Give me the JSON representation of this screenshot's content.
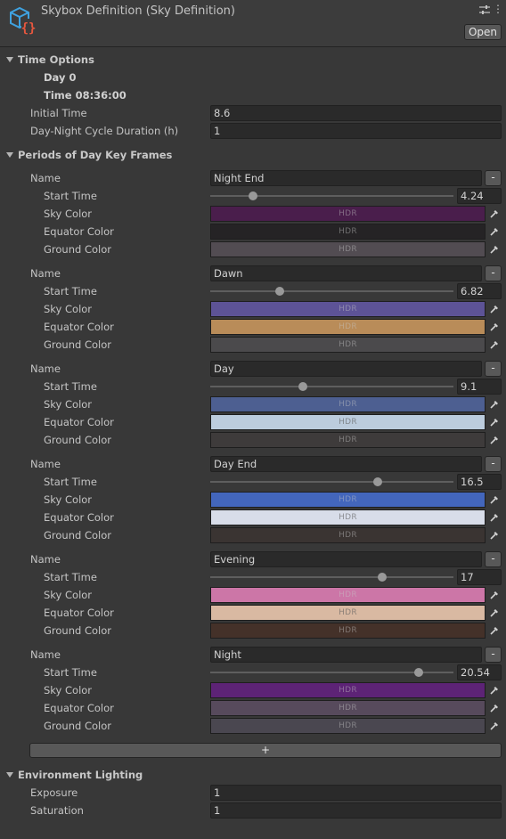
{
  "header": {
    "title": "Skybox Definition (Sky Definition)",
    "open_label": "Open",
    "icons": [
      "skybox-asset-icon",
      "settings-icon",
      "more-icon"
    ]
  },
  "time_options": {
    "title": "Time Options",
    "day_label": "Day 0",
    "time_label": "Time 08:36:00",
    "initial_time_label": "Initial Time",
    "initial_time_value": "8.6",
    "cycle_label": "Day-Night Cycle Duration (h)",
    "cycle_value": "1"
  },
  "periods": {
    "title": "Periods of Day Key Frames",
    "name_label": "Name",
    "start_time_label": "Start Time",
    "sky_color_label": "Sky Color",
    "equator_color_label": "Equator Color",
    "ground_color_label": "Ground Color",
    "hdr_label": "HDR",
    "remove_label": "-",
    "add_label": "+",
    "slider_range": [
      0,
      24
    ],
    "frames": [
      {
        "name": "Night End",
        "start": "4.24",
        "start_value": 4.24,
        "sky": "#4a1e4c",
        "equator": "#252325",
        "ground": "#524c52"
      },
      {
        "name": "Dawn",
        "start": "6.82",
        "start_value": 6.82,
        "sky": "#5d5396",
        "equator": "#b98c59",
        "ground": "#4b4a4c"
      },
      {
        "name": "Day",
        "start": "9.1",
        "start_value": 9.1,
        "sky": "#4d5f91",
        "equator": "#bcccdd",
        "ground": "#3e3b3b"
      },
      {
        "name": "Day End",
        "start": "16.5",
        "start_value": 16.5,
        "sky": "#4366bc",
        "equator": "#d8dde9",
        "ground": "#3a3432"
      },
      {
        "name": "Evening",
        "start": "17",
        "start_value": 17,
        "sky": "#cc76a7",
        "equator": "#d9b9a2",
        "ground": "#443129"
      },
      {
        "name": "Night",
        "start": "20.54",
        "start_value": 20.54,
        "sky": "#5d2376",
        "equator": "#574a5c",
        "ground": "#4a4750"
      }
    ]
  },
  "environment": {
    "title": "Environment Lighting",
    "exposure_label": "Exposure",
    "exposure_value": "1",
    "saturation_label": "Saturation",
    "saturation_value": "1"
  }
}
